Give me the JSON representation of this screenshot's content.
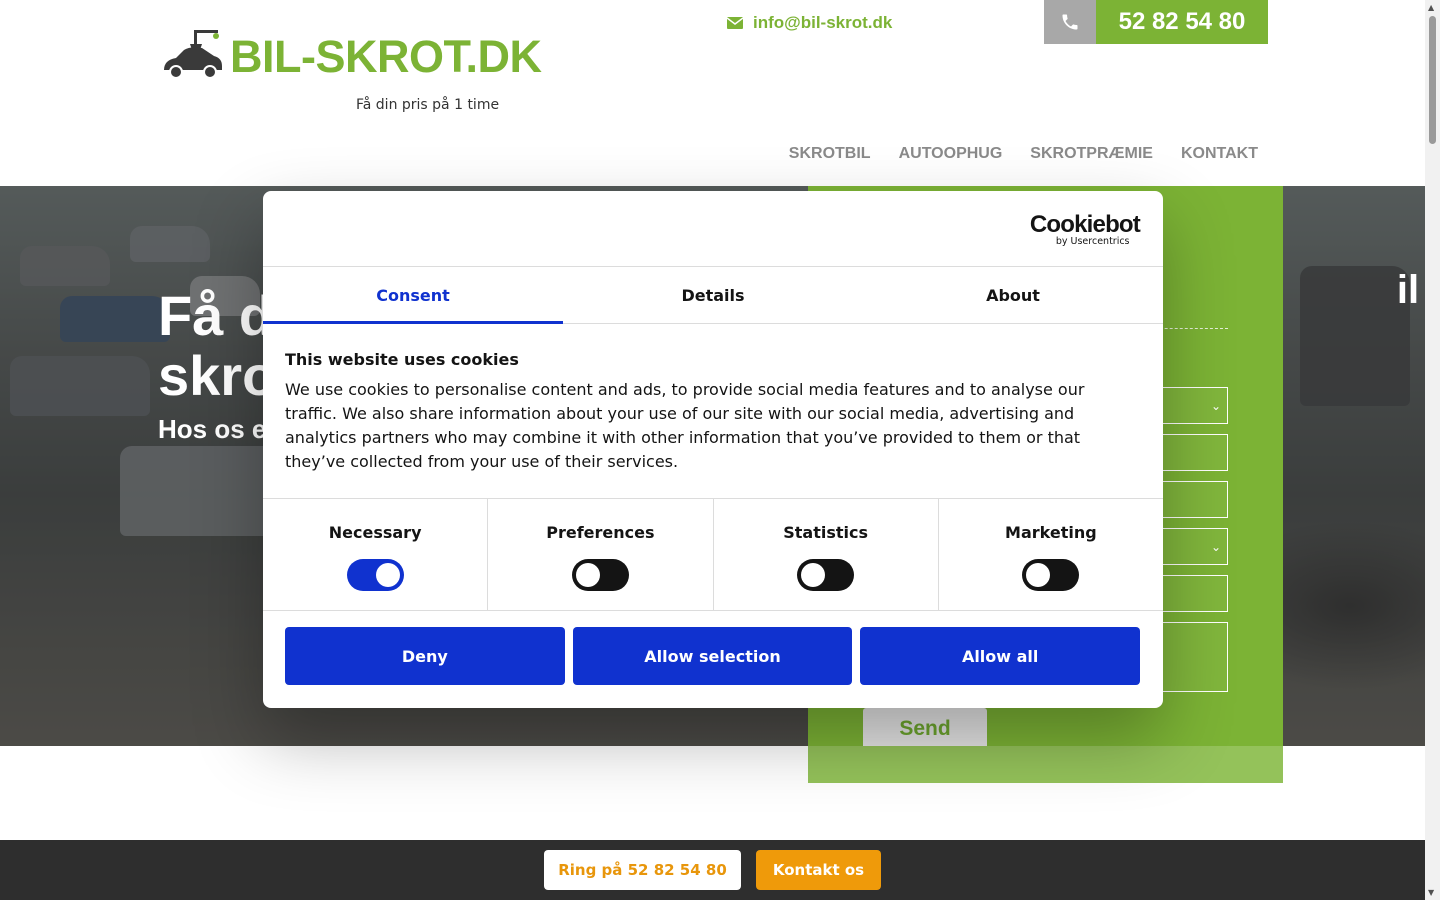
{
  "header": {
    "logo_text": "BIL-SKROT.DK",
    "tagline": "Få din pris på 1 time",
    "email": "info@bil-skrot.dk",
    "phone": "52 82 54 80"
  },
  "nav": {
    "items": [
      "SKROTBIL",
      "AUTOOPHUG",
      "SKROTPRÆMIE",
      "KONTAKT"
    ]
  },
  "hero": {
    "title_line1": "Få d",
    "title_line2": "skro",
    "subtitle": "Hos os e"
  },
  "form": {
    "heading_fragment": "il",
    "send_label": "Send"
  },
  "cookie": {
    "brand": "Cookiebot",
    "brand_sub": "by Usercentrics",
    "tabs": [
      "Consent",
      "Details",
      "About"
    ],
    "title": "This website uses cookies",
    "body": "We use cookies to personalise content and ads, to provide social media features and to analyse our traffic. We also share information about your use of our site with our social media, advertising and analytics partners who may combine it with other information that you’ve provided to them or that they’ve collected from your use of their services.",
    "preferences": [
      {
        "label": "Necessary",
        "enabled": true
      },
      {
        "label": "Preferences",
        "enabled": false
      },
      {
        "label": "Statistics",
        "enabled": false
      },
      {
        "label": "Marketing",
        "enabled": false
      }
    ],
    "buttons": {
      "deny": "Deny",
      "allow_selection": "Allow selection",
      "allow_all": "Allow all"
    }
  },
  "bottom_bar": {
    "call_label": "Ring på 52 82 54 80",
    "contact_label": "Kontakt os"
  },
  "colors": {
    "brand_green": "#7cb335",
    "cookie_blue": "#1032cf",
    "cta_orange": "#ef9a0a",
    "bottom_bar": "#2e2e2e"
  }
}
